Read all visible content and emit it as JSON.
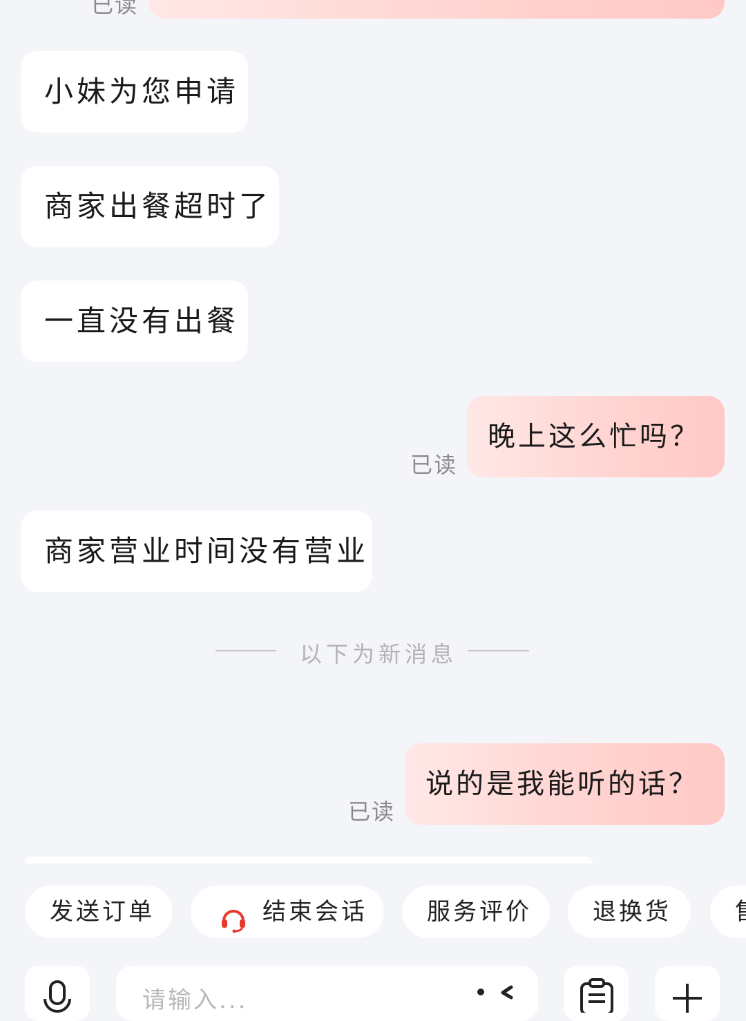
{
  "messages": {
    "top_read": "已读",
    "left_1": "小妹为您申请",
    "left_2": "商家出餐超时了",
    "left_3": "一直没有出餐",
    "right_1": "晚上这么忙吗？",
    "right_1_status": "已读",
    "left_4": "商家营业时间没有营业",
    "new_divider": "以下为新消息",
    "right_2": "说的是我能听的话？",
    "right_2_status": "已读"
  },
  "quick_actions": {
    "send_order": "发送订单",
    "end_session": "结束会话",
    "service_rating": "服务评价",
    "return_exchange": "退换货",
    "partial_next": "售"
  },
  "input": {
    "placeholder": "请输入..."
  },
  "colors": {
    "accent": "#e8392c",
    "bubble_right": "#ffd3d0",
    "bubble_left": "#ffffff",
    "background": "#f4f5f9"
  },
  "icons": [
    "headset-icon",
    "microphone-icon",
    "emoji-icon",
    "clipboard-icon",
    "plus-icon"
  ]
}
